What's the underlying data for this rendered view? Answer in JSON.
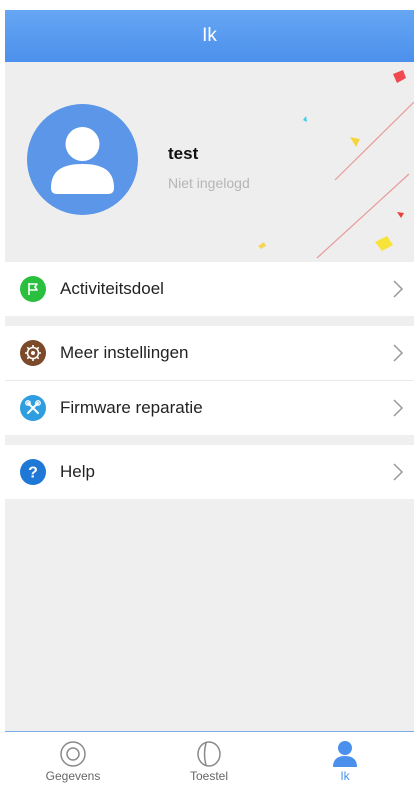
{
  "header": {
    "title": "Ik"
  },
  "profile": {
    "username": "test",
    "status": "Niet ingelogd"
  },
  "menu": [
    {
      "label": "Activiteitsdoel",
      "icon": "flag-icon",
      "color": "#2bbf3f"
    },
    {
      "label": "Meer instellingen",
      "icon": "gear-icon",
      "color": "#7a4a2a"
    },
    {
      "label": "Firmware reparatie",
      "icon": "wrench-screwdriver-icon",
      "color": "#2e9ee0"
    },
    {
      "label": "Help",
      "icon": "question-icon",
      "color": "#1f78d6"
    }
  ],
  "tabs": [
    {
      "label": "Gegevens",
      "icon": "target-icon",
      "active": false
    },
    {
      "label": "Toestel",
      "icon": "device-icon",
      "active": false
    },
    {
      "label": "Ik",
      "icon": "person-icon",
      "active": true
    }
  ],
  "colors": {
    "accent": "#4b90ec",
    "avatar": "#5b96e8"
  }
}
